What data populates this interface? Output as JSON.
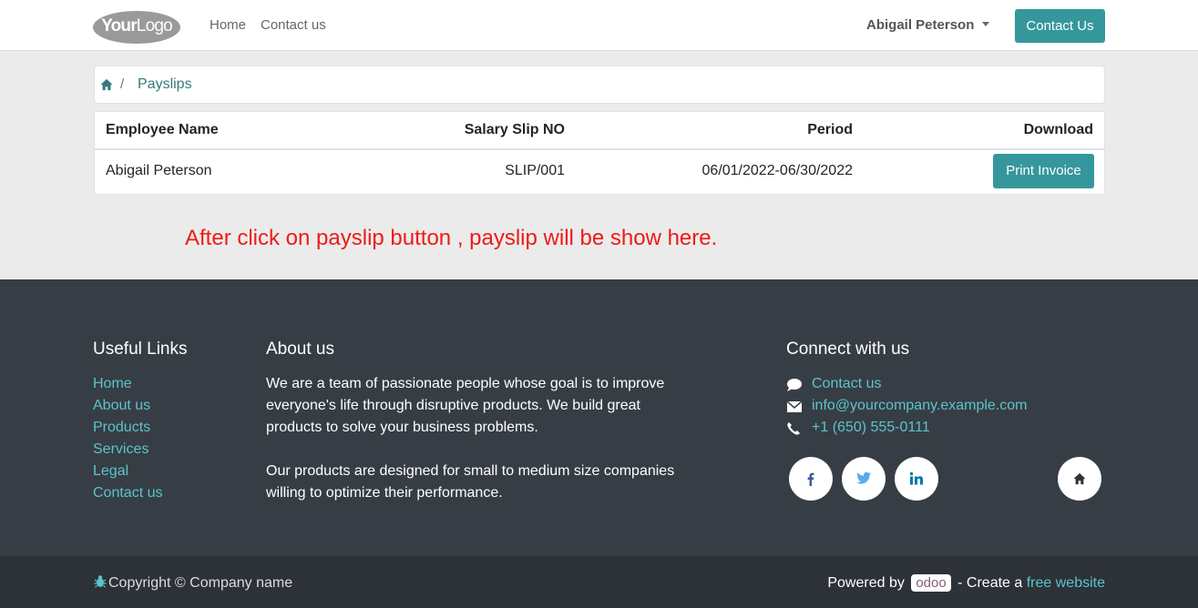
{
  "header": {
    "logo_bold": "Your",
    "logo_light": "Logo",
    "nav": [
      "Home",
      "Contact us"
    ],
    "user_name": "Abigail Peterson",
    "contact_button": "Contact Us"
  },
  "breadcrumb": {
    "current": "Payslips",
    "separator": "/"
  },
  "table": {
    "headers": [
      "Employee Name",
      "Salary Slip NO",
      "Period",
      "Download"
    ],
    "rows": [
      {
        "employee": "Abigail Peterson",
        "slip_no": "SLIP/001",
        "period": "06/01/2022-06/30/2022",
        "action": "Print Invoice"
      }
    ]
  },
  "note": "After click on payslip button , payslip will be show here.",
  "footer": {
    "useful_links_title": "Useful Links",
    "useful_links": [
      "Home",
      "About us",
      "Products",
      "Services",
      "Legal",
      "Contact us"
    ],
    "about_title": "About us",
    "about_p1": "We are a team of passionate people whose goal is to improve everyone's life through disruptive products. We build great products to solve your business problems.",
    "about_p2": "Our products are designed for small to medium size companies willing to optimize their performance.",
    "connect_title": "Connect with us",
    "contact_link": "Contact us",
    "email": "info@yourcompany.example.com",
    "phone": "+1 (650) 555-0111",
    "social_icons": [
      "facebook-icon",
      "twitter-icon",
      "linkedin-icon",
      "home-icon"
    ]
  },
  "copyright": {
    "text": "Copyright © Company name",
    "powered_by": "Powered by",
    "odoo": "odoo",
    "create": "- Create a",
    "free_website": "free website"
  },
  "colors": {
    "accent": "#35979c",
    "link": "#5bc4c9",
    "note": "#ee1b16",
    "footer_bg": "#373d45",
    "copyright_bg": "#2d3138"
  }
}
